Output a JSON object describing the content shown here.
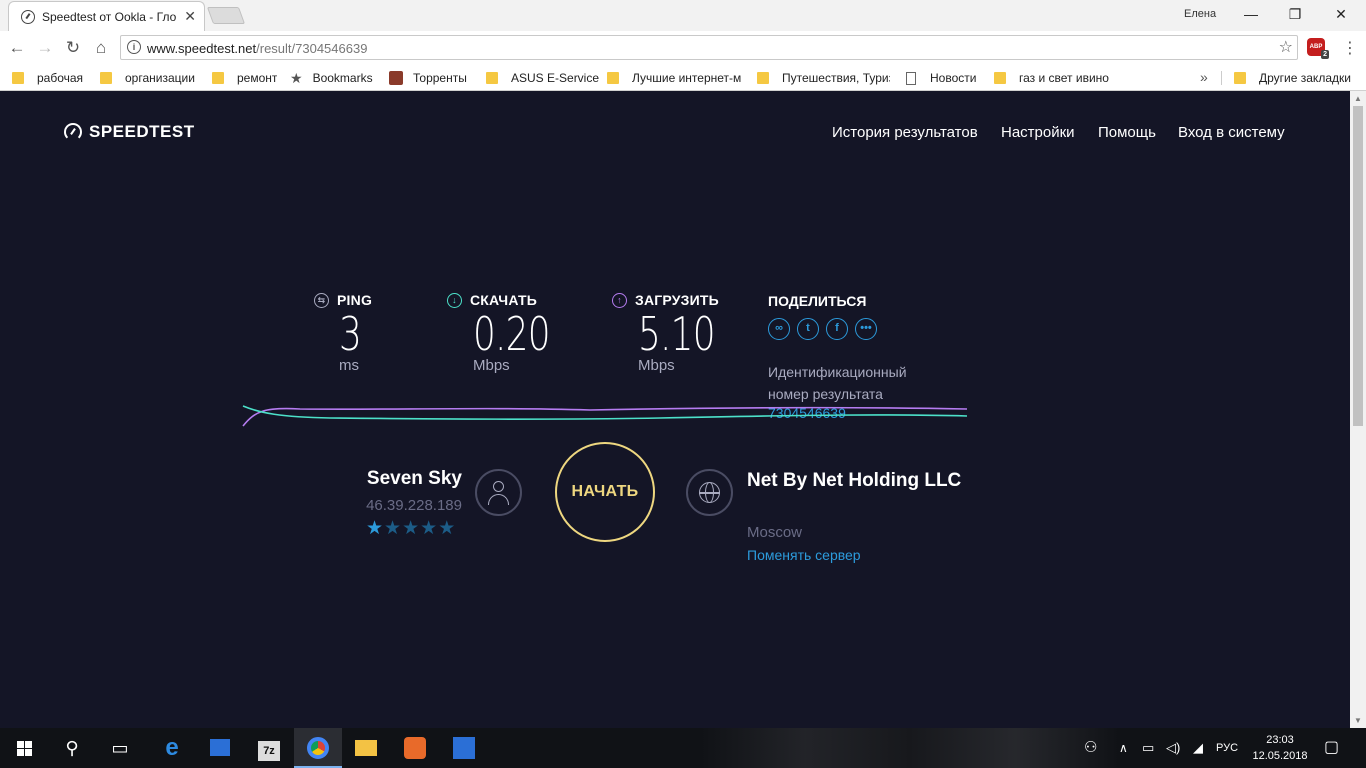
{
  "browser": {
    "tab_title": "Speedtest от Ookla - Гло",
    "tab_close": "✕",
    "user_name": "Елена",
    "window_controls": {
      "minimize": "—",
      "restore": "❐",
      "close": "✕"
    },
    "nav": {
      "back": "←",
      "forward": "→",
      "reload": "↻",
      "home": "⌂"
    },
    "url_host": "www.speedtest.net",
    "url_path": "/result/7304546639",
    "bookmark_star": "☆",
    "extension_label": "ABP",
    "extension_badge": "2",
    "menu": "⋮",
    "bookmarks": [
      {
        "label": "рабочая",
        "icon": "folder-icon"
      },
      {
        "label": "организации",
        "icon": "folder-icon"
      },
      {
        "label": "ремонт",
        "icon": "folder-icon"
      },
      {
        "label": "Bookmarks",
        "icon": "star-icon"
      },
      {
        "label": "Торренты",
        "icon": "torrent-icon"
      },
      {
        "label": "ASUS E-Service",
        "icon": "folder-icon"
      },
      {
        "label": "Лучшие интернет-м",
        "icon": "folder-icon"
      },
      {
        "label": "Путешествия, Туриз",
        "icon": "folder-icon"
      },
      {
        "label": "Новости",
        "icon": "page-icon"
      },
      {
        "label": "газ и свет ивино",
        "icon": "folder-icon"
      }
    ],
    "bookmarks_overflow": "»",
    "other_bookmarks": "Другие закладки"
  },
  "site": {
    "logo": "SPEEDTEST",
    "nav": [
      "История результатов",
      "Настройки",
      "Помощь",
      "Вход в систему"
    ]
  },
  "results": {
    "ping": {
      "label": "PING",
      "value": "3",
      "unit": "ms",
      "color": "#a9abc0",
      "icon": "ping-icon"
    },
    "download": {
      "label": "СКАЧАТЬ",
      "value": "0.20",
      "unit": "Mbps",
      "color": "#4ce1c9",
      "icon": "download-icon"
    },
    "upload": {
      "label": "ЗАГРУЗИТЬ",
      "value": "5.10",
      "unit": "Mbps",
      "color": "#b57cf0",
      "icon": "upload-icon"
    },
    "share_title": "ПОДЕЛИТЬСЯ",
    "share_icons": [
      "link-icon",
      "twitter-icon",
      "facebook-icon",
      "more-icon"
    ],
    "result_id_label": "Идентификационный номер результата",
    "result_id": "7304546639"
  },
  "isp": {
    "name": "Seven Sky",
    "ip": "46.39.228.189",
    "rating": 1,
    "rating_max": 5
  },
  "go_button": "НАЧАТЬ",
  "server": {
    "name": "Net By Net Holding LLC",
    "location": "Moscow",
    "change_label": "Поменять сервер"
  },
  "taskbar": {
    "apps": [
      "start",
      "search",
      "task-view",
      "edge",
      "store",
      "7zip",
      "chrome",
      "explorer",
      "eye-app",
      "settings-app"
    ],
    "language": "РУС",
    "time": "23:03",
    "date": "12.05.2018"
  }
}
